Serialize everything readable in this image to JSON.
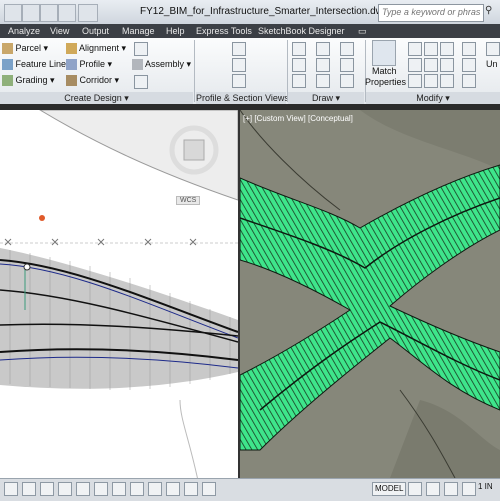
{
  "window": {
    "title": "FY12_BIM_for_Infrastructure_Smarter_Intersection.dwg"
  },
  "search": {
    "placeholder": "Type a keyword or phrase"
  },
  "menu_tabs": [
    "Analyze",
    "View",
    "Output",
    "Manage",
    "Help",
    "Express Tools",
    "SketchBook Designer"
  ],
  "ribbon": {
    "create_design": {
      "items": [
        "Parcel",
        "Feature Line",
        "Grading",
        "Alignment",
        "Profile",
        "Corridor",
        "Assembly"
      ],
      "title": "Create Design"
    },
    "profile_section": {
      "title": "Profile & Section Views"
    },
    "draw": {
      "title": "Draw"
    },
    "modify": {
      "title": "Modify",
      "match_label_1": "Match",
      "match_label_2": "Properties",
      "partial_label": "Un"
    }
  },
  "viewport": {
    "label": "[+] [Custom View] [Conceptual]",
    "wcs": "WCS"
  },
  "statusbar": {
    "model": "MODEL",
    "scale": "1 IN"
  },
  "colors": {
    "accent": "#3b3f45",
    "road": "#3ee58b",
    "terrain": "#86877a"
  }
}
